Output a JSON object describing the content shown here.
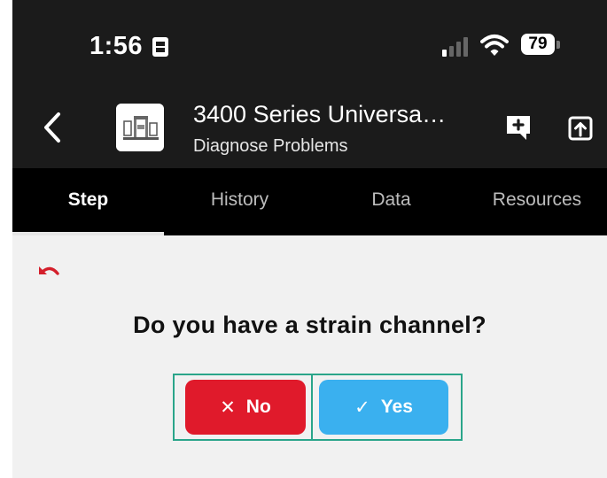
{
  "status_bar": {
    "time": "1:56",
    "battery": "79"
  },
  "app_bar": {
    "title": "3400 Series Universa…",
    "subtitle": "Diagnose Problems"
  },
  "tabs": [
    {
      "label": "Step",
      "active": true
    },
    {
      "label": "History",
      "active": false
    },
    {
      "label": "Data",
      "active": false
    },
    {
      "label": "Resources",
      "active": false
    }
  ],
  "step": {
    "question": "Do you have a strain channel?",
    "no_label": "No",
    "yes_label": "Yes"
  },
  "colors": {
    "bar_background": "#1b1b1b",
    "no_button": "#e01a2b",
    "yes_button": "#3ab0ef",
    "highlight_outline": "#2aa58a",
    "undo_icon": "#d41f2b"
  },
  "icons": [
    "sim-card-icon",
    "signal-icon",
    "wifi-icon",
    "battery-icon",
    "back-chevron-icon",
    "product-thumbnail",
    "add-comment-icon",
    "share-icon",
    "undo-icon",
    "close-icon",
    "check-icon"
  ]
}
